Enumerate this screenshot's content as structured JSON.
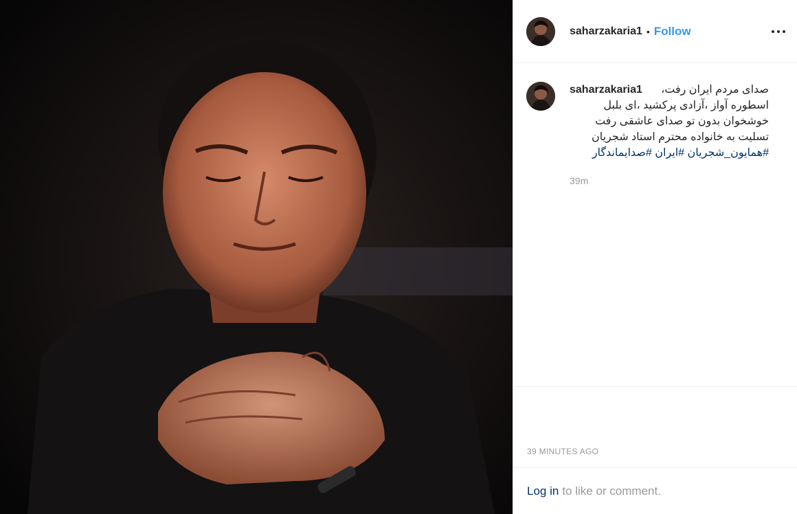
{
  "post": {
    "image_description_icon": "portrait-photo"
  },
  "header": {
    "username": "saharzakaria1",
    "separator": "•",
    "follow_label": "Follow",
    "more_icon": "ellipsis-icon"
  },
  "comment": {
    "username": "saharzakaria1",
    "line1": "صدای مردم ایران رفت،",
    "line2": "اسطوره آواز ،آزادی پرکشید ،ای بلبل",
    "line3": "خوشخوان بدون تو صدای عاشقی رفت",
    "line4": "تسلیت به خانواده محترم استاد شجریان",
    "hashtags": [
      "#همایون_شجریان",
      "#ایران",
      "#صدایماندگار"
    ],
    "time": "39m"
  },
  "footer": {
    "timestamp": "39 MINUTES AGO",
    "login_link": "Log in",
    "login_rest": "to like or comment."
  },
  "colors": {
    "follow": "#3897f0",
    "link": "#003569",
    "muted": "#999999",
    "border": "#efefef"
  }
}
